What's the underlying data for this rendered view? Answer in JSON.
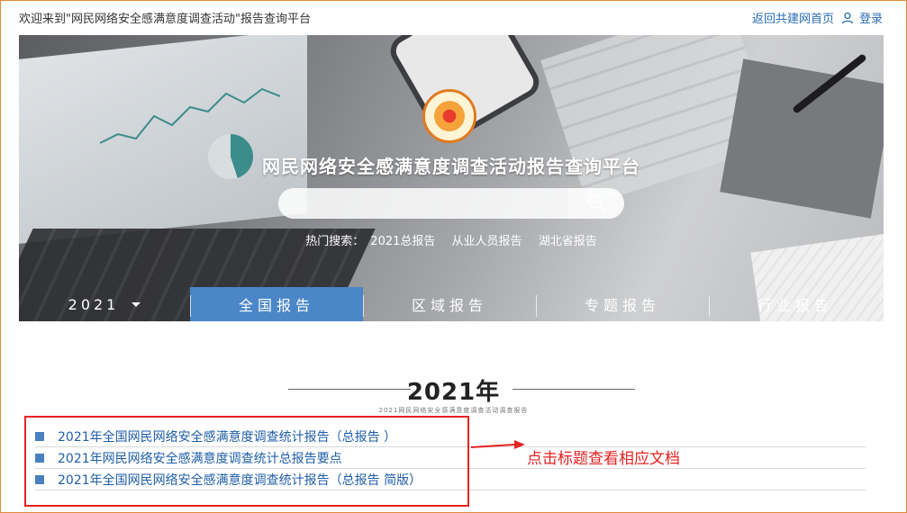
{
  "header": {
    "welcome": "欢迎来到\"网民网络安全感满意度调查活动\"报告查询平台",
    "home_link": "返回共建网首页",
    "login": "登录"
  },
  "banner": {
    "title": "网民网络安全感满意度调查活动报告查询平台",
    "search_placeholder": "",
    "hot_label": "热门搜索：",
    "hot_items": [
      "2021总报告",
      "从业人员报告",
      "湖北省报告"
    ]
  },
  "nav": {
    "year": "2021",
    "tabs": [
      "全国报告",
      "区域报告",
      "专题报告",
      "行业报告"
    ],
    "active_tab": 0
  },
  "section": {
    "year_title": "2021年",
    "subtitle": "2021网民网络安全感满意度调查活动调查报告"
  },
  "reports": [
    "2021年全国网民网络安全感满意度调查统计报告（总报告 ）",
    "2021年网民网络安全感满意度调查统计总报告要点",
    "2021年全国网民网络安全感满意度调查统计报告（总报告 简版）"
  ],
  "annotation": {
    "text": "点击标题查看相应文档",
    "color": "#e62222"
  },
  "colors": {
    "accent": "#4a86c8",
    "link": "#1f5ea8",
    "frame": "#e08a3c"
  }
}
